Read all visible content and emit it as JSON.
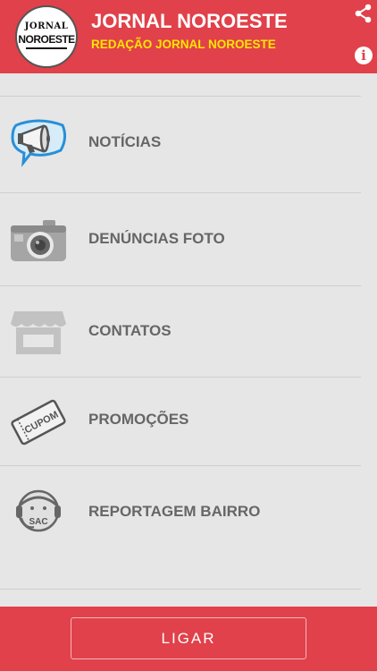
{
  "header": {
    "logo_line1": "JORNAL",
    "logo_line2": "NOROESTE",
    "title": "JORNAL NOROESTE",
    "subtitle": "REDAÇÃO JORNAL NOROESTE",
    "share_icon": "share-icon",
    "info_icon": "info-icon",
    "info_glyph": "i"
  },
  "menu": {
    "items": [
      {
        "label": "NOTÍCIAS",
        "icon": "megaphone-icon"
      },
      {
        "label": "DENÚNCIAS FOTO",
        "icon": "camera-icon"
      },
      {
        "label": "CONTATOS",
        "icon": "store-icon"
      },
      {
        "label": "PROMOÇÕES",
        "icon": "coupon-icon"
      },
      {
        "label": "REPORTAGEM BAIRRO",
        "icon": "sac-agent-icon"
      }
    ],
    "coupon_text": "CUPOM",
    "sac_text": "SAC"
  },
  "footer": {
    "call_label": "LIGAR"
  },
  "colors": {
    "brand_red": "#e0414a",
    "subtitle_yellow": "#ffe600",
    "background": "#e6e6e6",
    "label_gray": "#666666"
  }
}
